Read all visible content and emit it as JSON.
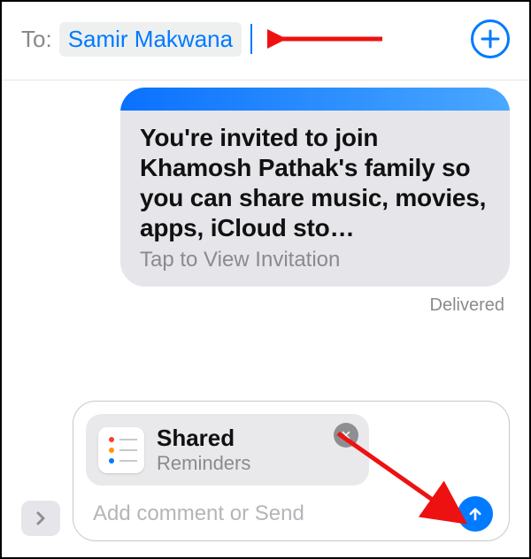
{
  "to_bar": {
    "label": "To:",
    "recipient": "Samir Makwana",
    "add_icon": "plus-icon"
  },
  "message": {
    "title_lines": "You're invited to join Khamosh Pathak's family so you can share music, movies, apps, iCloud sto…",
    "subtitle": "Tap to View Invitation",
    "status": "Delivered"
  },
  "compose": {
    "expand_icon": "chevron-right-icon",
    "attachment": {
      "title": "Shared",
      "subtitle": "Reminders",
      "close_icon": "close-icon"
    },
    "placeholder": "Add comment or Send",
    "send_icon": "arrow-up-icon"
  },
  "annotation": {
    "arrow_color": "#e11"
  }
}
